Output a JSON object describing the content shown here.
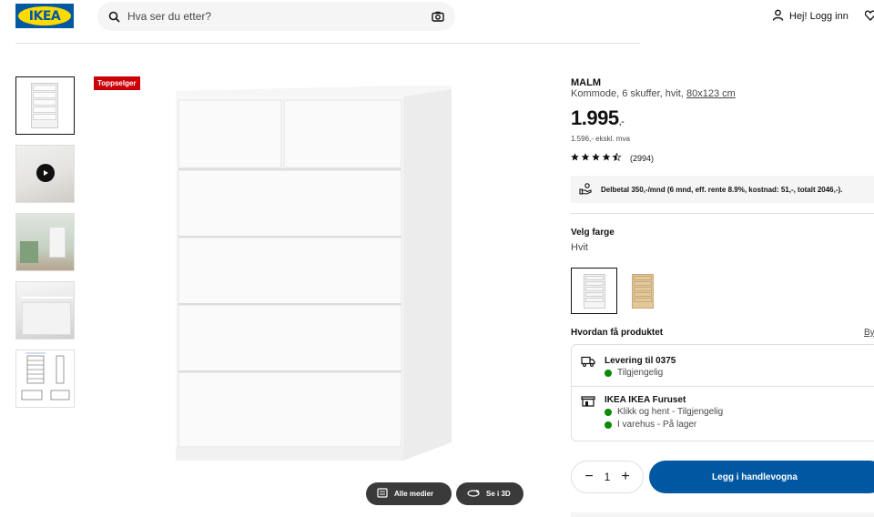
{
  "header": {
    "logo_text": "IKEA",
    "search_placeholder": "Hva ser du etter?",
    "login_label": "Hej! Logg inn",
    "icons": [
      "search-icon",
      "camera-icon",
      "user-icon",
      "heart-icon"
    ]
  },
  "gallery": {
    "thumbnails": [
      "front-white",
      "video",
      "room-scene",
      "detail-closeup",
      "dimension-drawing"
    ],
    "selected_index": 0,
    "badge": "Toppselger",
    "all_media_label": "Alle medier",
    "view_3d_label": "Se i 3D"
  },
  "product": {
    "name": "MALM",
    "description": "Kommode, 6 skuffer, hvit,",
    "dimensions": "80x123 cm",
    "price_main": "1.995",
    "price_suffix": ",-",
    "price_ex_vat": "1.596,- ekskl. mva",
    "rating_stars": 4.5,
    "review_count": "(2994)",
    "installment_text": "Delbetal 350,-/mnd (6 mnd, eff. rente 8.9%, kostnad: 51,-, totalt 2046,-)."
  },
  "color": {
    "label": "Velg farge",
    "value": "Hvit",
    "swatch_colors": [
      "#f6f6f6",
      "#e5c898"
    ]
  },
  "delivery": {
    "title": "Hvordan få produktet",
    "link_text": "By",
    "shipping_title": "Levering til 0375",
    "shipping_status": "Tilgjengelig",
    "store_title": "IKEA IKEA Furuset",
    "store_pickup": "Klikk og hent - Tilgjengelig",
    "store_stock": "I varehus - På lager",
    "status_color": "#0a8a00"
  },
  "purchase": {
    "quantity": "1",
    "minus": "−",
    "plus": "+",
    "cart_label": "Legg i handlevogna"
  },
  "colors": {
    "brand_blue": "#0058a3",
    "brand_yellow": "#ffdb00",
    "badge_red": "#cc0008"
  }
}
